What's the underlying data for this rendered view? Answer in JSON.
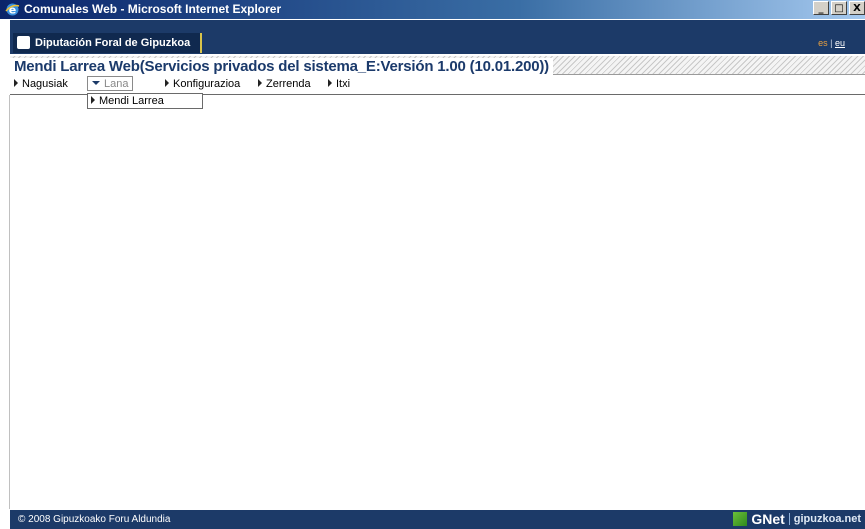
{
  "window": {
    "title": "Comunales Web - Microsoft Internet Explorer",
    "minimize": "_",
    "maximize": "□",
    "close": "X"
  },
  "header": {
    "org": "Diputación Foral de Gipuzkoa",
    "lang_es": "es",
    "lang_sep": "|",
    "lang_eu": "eu"
  },
  "app": {
    "title": "Mendi Larrea Web(Servicios privados del sistema_E:Versión 1.00 (10.01.200))"
  },
  "menu": {
    "items": [
      "Nagusiak",
      "Lana",
      "Konfigurazioa",
      "Zerrenda",
      "Itxi"
    ],
    "active": "Lana",
    "dropdown_items": [
      "Mendi Larrea"
    ]
  },
  "footer": {
    "copyright": "© 2008  Gipuzkoako Foru Aldundia",
    "brand": "GNet",
    "site": "gipuzkoa.net"
  },
  "colors": {
    "header_bg": "#1c3a68",
    "title_text": "#1b3a6b"
  }
}
